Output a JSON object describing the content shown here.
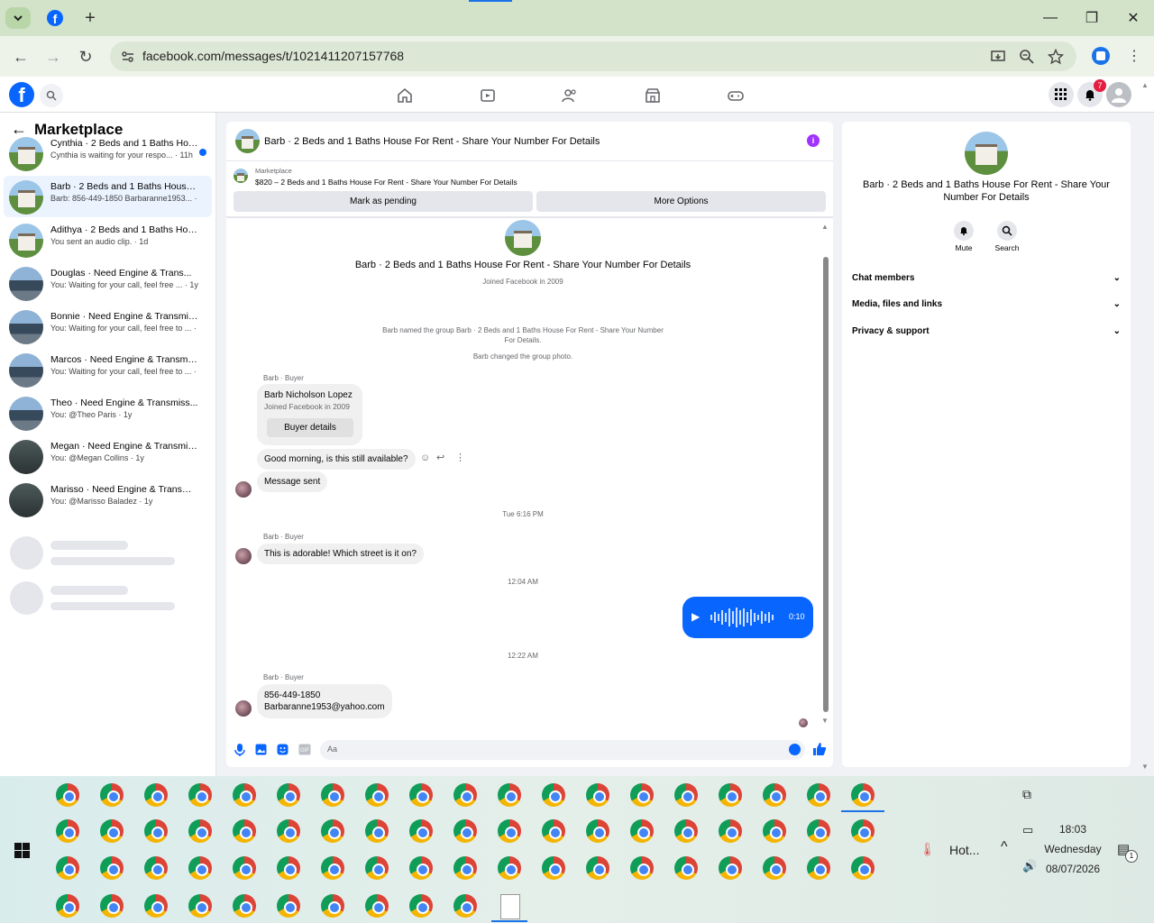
{
  "browser": {
    "url": "facebook.com/messages/t/1021411207157768",
    "new_tab_label": "+"
  },
  "header": {
    "notification_count": "7"
  },
  "sidebar": {
    "title": "Marketplace",
    "conversations": [
      {
        "name": "Cynthia · 2 Beds and 1 Baths Hou...",
        "snippet": "Cynthia is waiting for your respo... · 11h",
        "avatar": "house",
        "unread": true
      },
      {
        "name": "Barb · 2 Beds and 1 Baths House F...",
        "snippet": "Barb: 856-449-1850 Barbaranne1953... · 17h",
        "avatar": "house",
        "selected": true
      },
      {
        "name": "Adithya · 2 Beds and 1 Baths Hous...",
        "snippet": "You sent an audio clip. · 1d",
        "avatar": "house"
      },
      {
        "name": "Douglas · Need Engine & Trans...",
        "snippet": "You: Waiting for your call, feel free ... · 1y",
        "avatar": "truck"
      },
      {
        "name": "Bonnie · Need Engine & Transmissi...",
        "snippet": "You: Waiting for your call, feel free to ... · 1y",
        "avatar": "truck"
      },
      {
        "name": "Marcos · Need Engine & Transmiss...",
        "snippet": "You: Waiting for your call, feel free to ... · 1y",
        "avatar": "truck"
      },
      {
        "name": "Theo · Need Engine & Transmiss...",
        "snippet": "You: @Theo Paris · 1y",
        "avatar": "truck"
      },
      {
        "name": "Megan · Need Engine & Transmissi...",
        "snippet": "You: @Megan Collins · 1y",
        "avatar": "dark"
      },
      {
        "name": "Marisso · Need Engine & Transmis...",
        "snippet": "You: @Marisso Baladez · 1y",
        "avatar": "dark"
      }
    ]
  },
  "chat": {
    "title": "Barb · 2 Beds and 1 Baths House For Rent - Share Your Number For Details",
    "marketplace_label": "Marketplace",
    "listing": "$820 – 2 Beds and 1 Baths House For Rent - Share Your Number For Details",
    "mark_pending": "Mark as pending",
    "more_options": "More Options",
    "intro_title": "Barb · 2 Beds and 1 Baths House For Rent - Share Your Number For Details",
    "joined": "Joined Facebook in 2009",
    "sys1": "Barb named the group Barb · 2 Beds and 1 Baths House For Rent - Share Your Number For Details.",
    "sys2": "Barb changed the group photo.",
    "buyer_label": "Barb · Buyer",
    "buyer_name": "Barb Nicholson Lopez",
    "buyer_joined": "Joined Facebook in 2009",
    "buyer_details": "Buyer details",
    "msg1": "Good morning, is this still available?",
    "msg2": "Message sent",
    "time1": "Tue 6:16 PM",
    "msg3": "This is adorable! Which street is it on?",
    "time2": "12:04 AM",
    "audio_duration": "0:10",
    "time3": "12:22 AM",
    "msg4_line1": "856-449-1850",
    "msg4_line2": "Barbaranne1953@yahoo.com",
    "input_placeholder": "Aa"
  },
  "info": {
    "title": "Barb · 2 Beds and 1 Baths House For Rent - Share Your Number For Details",
    "mute": "Mute",
    "search": "Search",
    "sections": [
      "Chat members",
      "Media, files and links",
      "Privacy & support"
    ]
  },
  "taskbar": {
    "weather": "Hot...",
    "time": "18:03",
    "day": "Wednesday",
    "date": "08/07/2026",
    "notif_count": "1"
  },
  "colors": {
    "accent": "#0866ff",
    "messenger_purple": "#a033ff",
    "badge": "#e41e3f"
  }
}
